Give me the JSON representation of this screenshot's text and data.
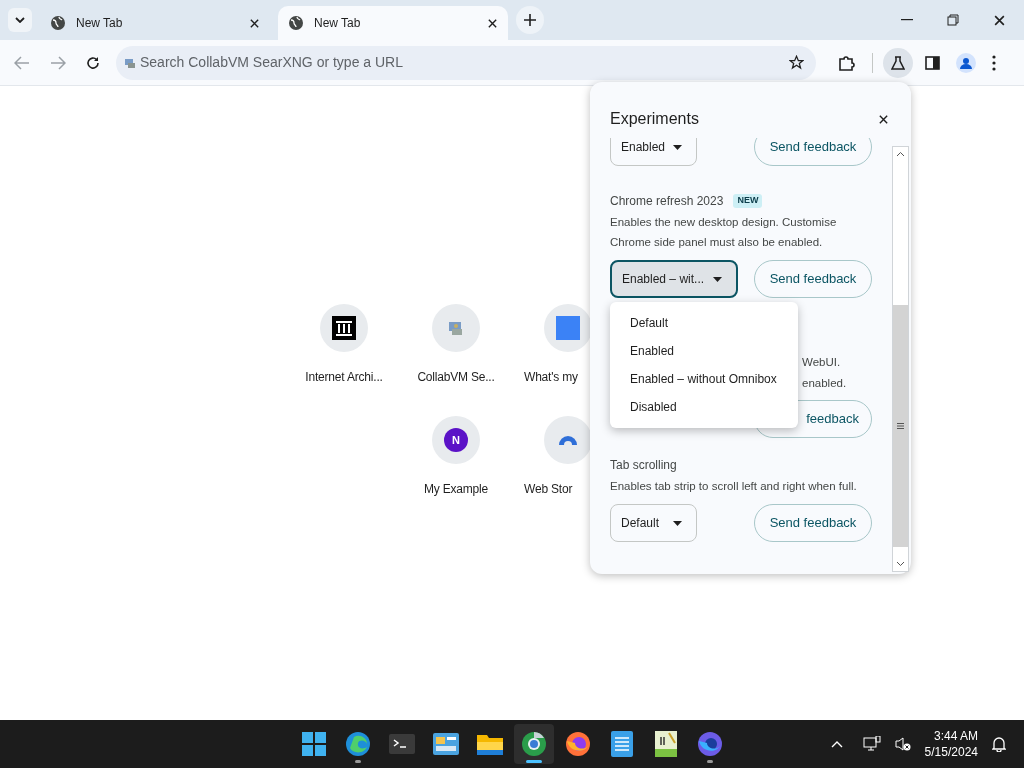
{
  "tabs": [
    {
      "title": "New Tab",
      "selected": false
    },
    {
      "title": "New Tab",
      "selected": true
    }
  ],
  "omnibox": {
    "placeholder": "Search CollabVM SearXNG or type a URL"
  },
  "shortcuts": [
    {
      "label": "Internet Archi...",
      "kind": "archive"
    },
    {
      "label": "CollabVM Se...",
      "kind": "collab"
    },
    {
      "label": "What's my",
      "kind": "ua"
    },
    {
      "label": "My Example",
      "kind": "letter",
      "letter": "N"
    },
    {
      "label": "Web Stor",
      "kind": "store"
    }
  ],
  "experiments_panel": {
    "title": "Experiments",
    "experiments": [
      {
        "kind": "cut_top",
        "select": "Enabled",
        "focused": false,
        "button": "Send feedback"
      },
      {
        "kind": "full",
        "name": "Chrome refresh 2023",
        "badge": "NEW",
        "description": "Enables the new desktop design. Customise Chrome side panel must also be enabled.",
        "select": "Enabled – wit...",
        "focused": true,
        "button": "Send feedback"
      },
      {
        "kind": "covered",
        "description_lines": [
          "WebUI.",
          "enabled."
        ],
        "button": "feedback"
      },
      {
        "kind": "full",
        "name": "Tab scrolling",
        "description": "Enables tab strip to scroll left and right when full.",
        "select": "Default",
        "focused": false,
        "button": "Send feedback"
      }
    ],
    "menu": {
      "options": [
        "Default",
        "Enabled",
        "Enabled – without Omnibox",
        "Disabled"
      ]
    }
  },
  "taskbar": {
    "apps": [
      {
        "kind": "start",
        "running": false,
        "active": false
      },
      {
        "kind": "edge",
        "running": true,
        "active": false
      },
      {
        "kind": "terminal",
        "running": false,
        "active": false
      },
      {
        "kind": "control",
        "running": false,
        "active": false
      },
      {
        "kind": "folder",
        "running": false,
        "active": false
      },
      {
        "kind": "chrome",
        "running": true,
        "active": true
      },
      {
        "kind": "firefox",
        "running": false,
        "active": false
      },
      {
        "kind": "notepad",
        "running": false,
        "active": false
      },
      {
        "kind": "notepadpp",
        "running": false,
        "active": false
      },
      {
        "kind": "nightly",
        "running": true,
        "active": false
      }
    ],
    "time": "3:44 AM",
    "date": "5/15/2024"
  }
}
